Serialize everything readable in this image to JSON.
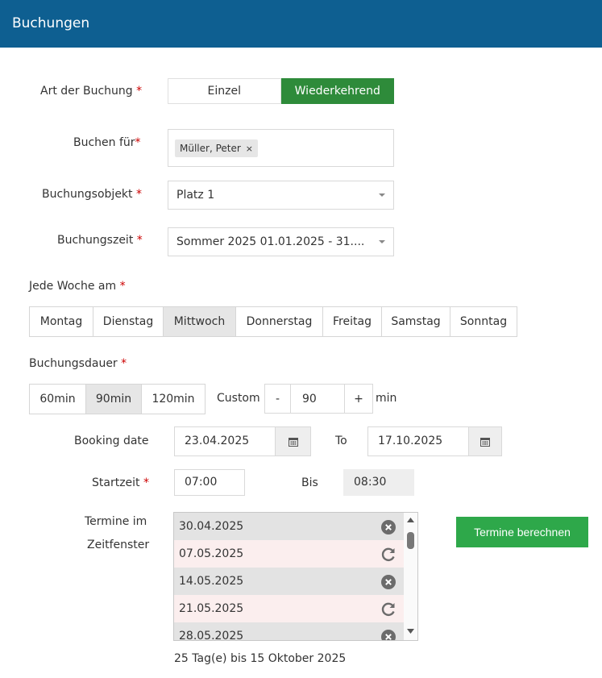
{
  "header": {
    "title": "Buchungen"
  },
  "form": {
    "booking_type": {
      "label": "Art der Buchung",
      "required_mark": "*",
      "options": [
        "Einzel",
        "Wiederkehrend"
      ],
      "selected": "Wiederkehrend"
    },
    "book_for": {
      "label": "Buchen für",
      "required_mark": "*",
      "chip_label": "Müller, Peter",
      "chip_remove": "×"
    },
    "booking_object": {
      "label": "Buchungsobjekt",
      "required_mark": "*",
      "value": "Platz 1"
    },
    "booking_time": {
      "label": "Buchungszeit",
      "required_mark": "*",
      "value": "Sommer 2025 01.01.2025 - 31...."
    },
    "weekday": {
      "label": "Jede Woche am",
      "required_mark": "*",
      "days": [
        "Montag",
        "Dienstag",
        "Mittwoch",
        "Donnerstag",
        "Freitag",
        "Samstag",
        "Sonntag"
      ],
      "selected": "Mittwoch"
    },
    "duration": {
      "label": "Buchungsdauer",
      "required_mark": "*",
      "options": [
        "60min",
        "90min",
        "120min"
      ],
      "selected": "90min",
      "custom_label": "Custom",
      "minus": "-",
      "value": "90",
      "plus": "+",
      "unit": "min"
    },
    "booking_date": {
      "label": "Booking date",
      "from": "23.04.2025",
      "to_label": "To",
      "to": "17.10.2025"
    },
    "start_time": {
      "label": "Startzeit",
      "required_mark": "*",
      "from": "07:00",
      "bis_label": "Bis",
      "to": "08:30"
    },
    "appointments": {
      "label_line1": "Termine im",
      "label_line2": "Zeitfenster",
      "items": [
        {
          "date": "30.04.2025",
          "icon": "remove-circle-icon"
        },
        {
          "date": "07.05.2025",
          "icon": "restore-icon"
        },
        {
          "date": "14.05.2025",
          "icon": "remove-circle-icon"
        },
        {
          "date": "21.05.2025",
          "icon": "restore-icon"
        },
        {
          "date": "28.05.2025",
          "icon": "remove-circle-icon"
        }
      ],
      "summary": "25 Tag(e) bis 15 Oktober 2025",
      "calculate_button": "Termine berechnen"
    }
  },
  "colors": {
    "header_bg": "#0e5f91",
    "active_green": "#2e8b3a",
    "button_green": "#2ea84a",
    "required_red": "#cc0000"
  }
}
